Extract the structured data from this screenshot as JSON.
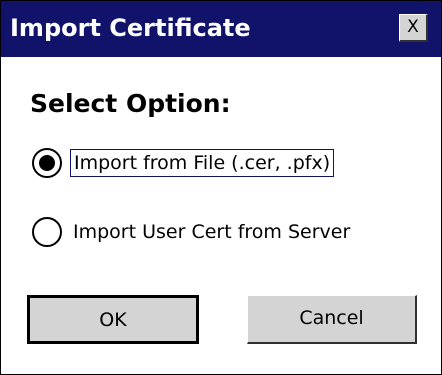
{
  "window": {
    "title": "Import Certificate",
    "close_label": "X"
  },
  "dialog": {
    "heading": "Select Option:",
    "options": [
      {
        "label": "Import from File  (.cer, .pfx)",
        "selected": true
      },
      {
        "label": "Import User Cert from Server",
        "selected": false
      }
    ],
    "ok_label": "OK",
    "cancel_label": "Cancel"
  },
  "colors": {
    "titlebar": "#11136b",
    "button_face": "#d4d4d4"
  }
}
